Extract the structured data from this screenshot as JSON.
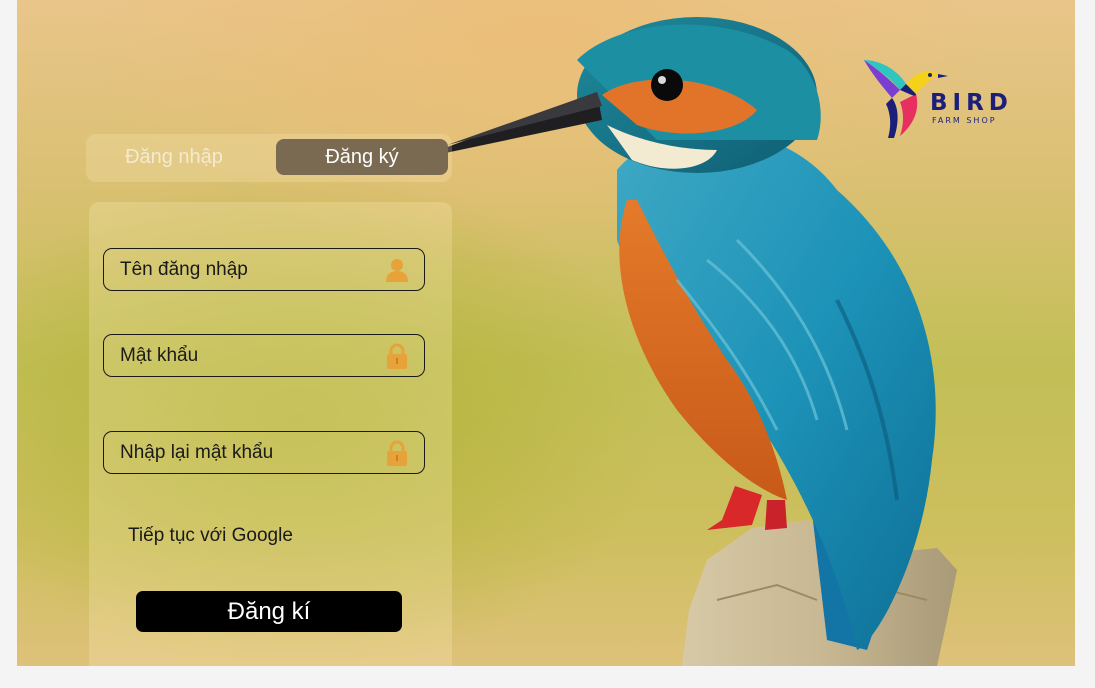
{
  "tabs": {
    "login_label": "Đăng nhập",
    "register_label": "Đăng ký"
  },
  "form": {
    "username_placeholder": "Tên đăng nhập",
    "password_placeholder": "Mật khẩu",
    "confirm_password_placeholder": "Nhập lại mật khẩu",
    "google_label": "Tiếp tục với Google",
    "submit_label": "Đăng kí"
  },
  "logo": {
    "word": "BIRD",
    "sub": "FARM SHOP"
  },
  "icons": {
    "username": "user-icon",
    "password": "lock-icon",
    "confirm_password": "lock-icon"
  },
  "colors": {
    "icon_accent": "#e8a23a",
    "active_tab_bg": "#7a6a52",
    "submit_bg": "#000000",
    "logo_primary": "#1c1f7a"
  }
}
